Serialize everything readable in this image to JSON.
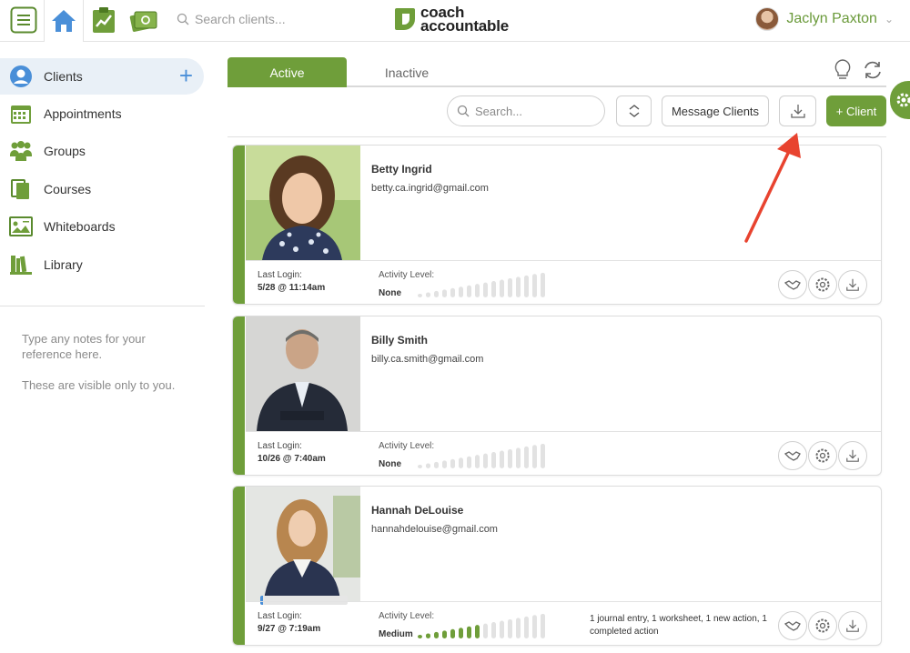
{
  "header": {
    "search_placeholder": "Search clients...",
    "logo_line1": "coach",
    "logo_line2": "accountable",
    "user_name": "Jaclyn Paxton"
  },
  "sidebar": {
    "items": [
      {
        "label": "Clients",
        "icon": "person-circle-icon"
      },
      {
        "label": "Appointments",
        "icon": "calendar-icon"
      },
      {
        "label": "Groups",
        "icon": "group-icon"
      },
      {
        "label": "Courses",
        "icon": "courses-icon"
      },
      {
        "label": "Whiteboards",
        "icon": "whiteboard-icon"
      },
      {
        "label": "Library",
        "icon": "library-icon"
      }
    ],
    "notes": [
      "Type any notes for your reference here.",
      "These are visible only to you."
    ]
  },
  "tabs": {
    "active": "Active",
    "inactive": "Inactive"
  },
  "toolbar": {
    "search_placeholder": "Search...",
    "message_label": "Message Clients",
    "add_label": "+ Client"
  },
  "clients": [
    {
      "name": "Betty Ingrid",
      "email": "betty.ca.ingrid@gmail.com",
      "login_label": "Last Login:",
      "last_login": "5/28 @ 11:14am",
      "activity_label": "Activity Level:",
      "activity": "None",
      "activity_filled": 0,
      "summary": ""
    },
    {
      "name": "Billy Smith",
      "email": "billy.ca.smith@gmail.com",
      "login_label": "Last Login:",
      "last_login": "10/26 @ 7:40am",
      "activity_label": "Activity Level:",
      "activity": "None",
      "activity_filled": 0,
      "summary": ""
    },
    {
      "name": "Hannah DeLouise",
      "email": "hannahdelouise@gmail.com",
      "login_label": "Last Login:",
      "last_login": "9/27 @ 7:19am",
      "activity_label": "Activity Level:",
      "activity": "Medium",
      "activity_filled": 8,
      "progress": 0.03,
      "summary": "1 journal entry, 1 worksheet, 1 new action, 1 completed action"
    }
  ],
  "colors": {
    "brand_green": "#6f9e3a",
    "accent_blue": "#4a8fd8",
    "annotation_red": "#e8432f"
  }
}
